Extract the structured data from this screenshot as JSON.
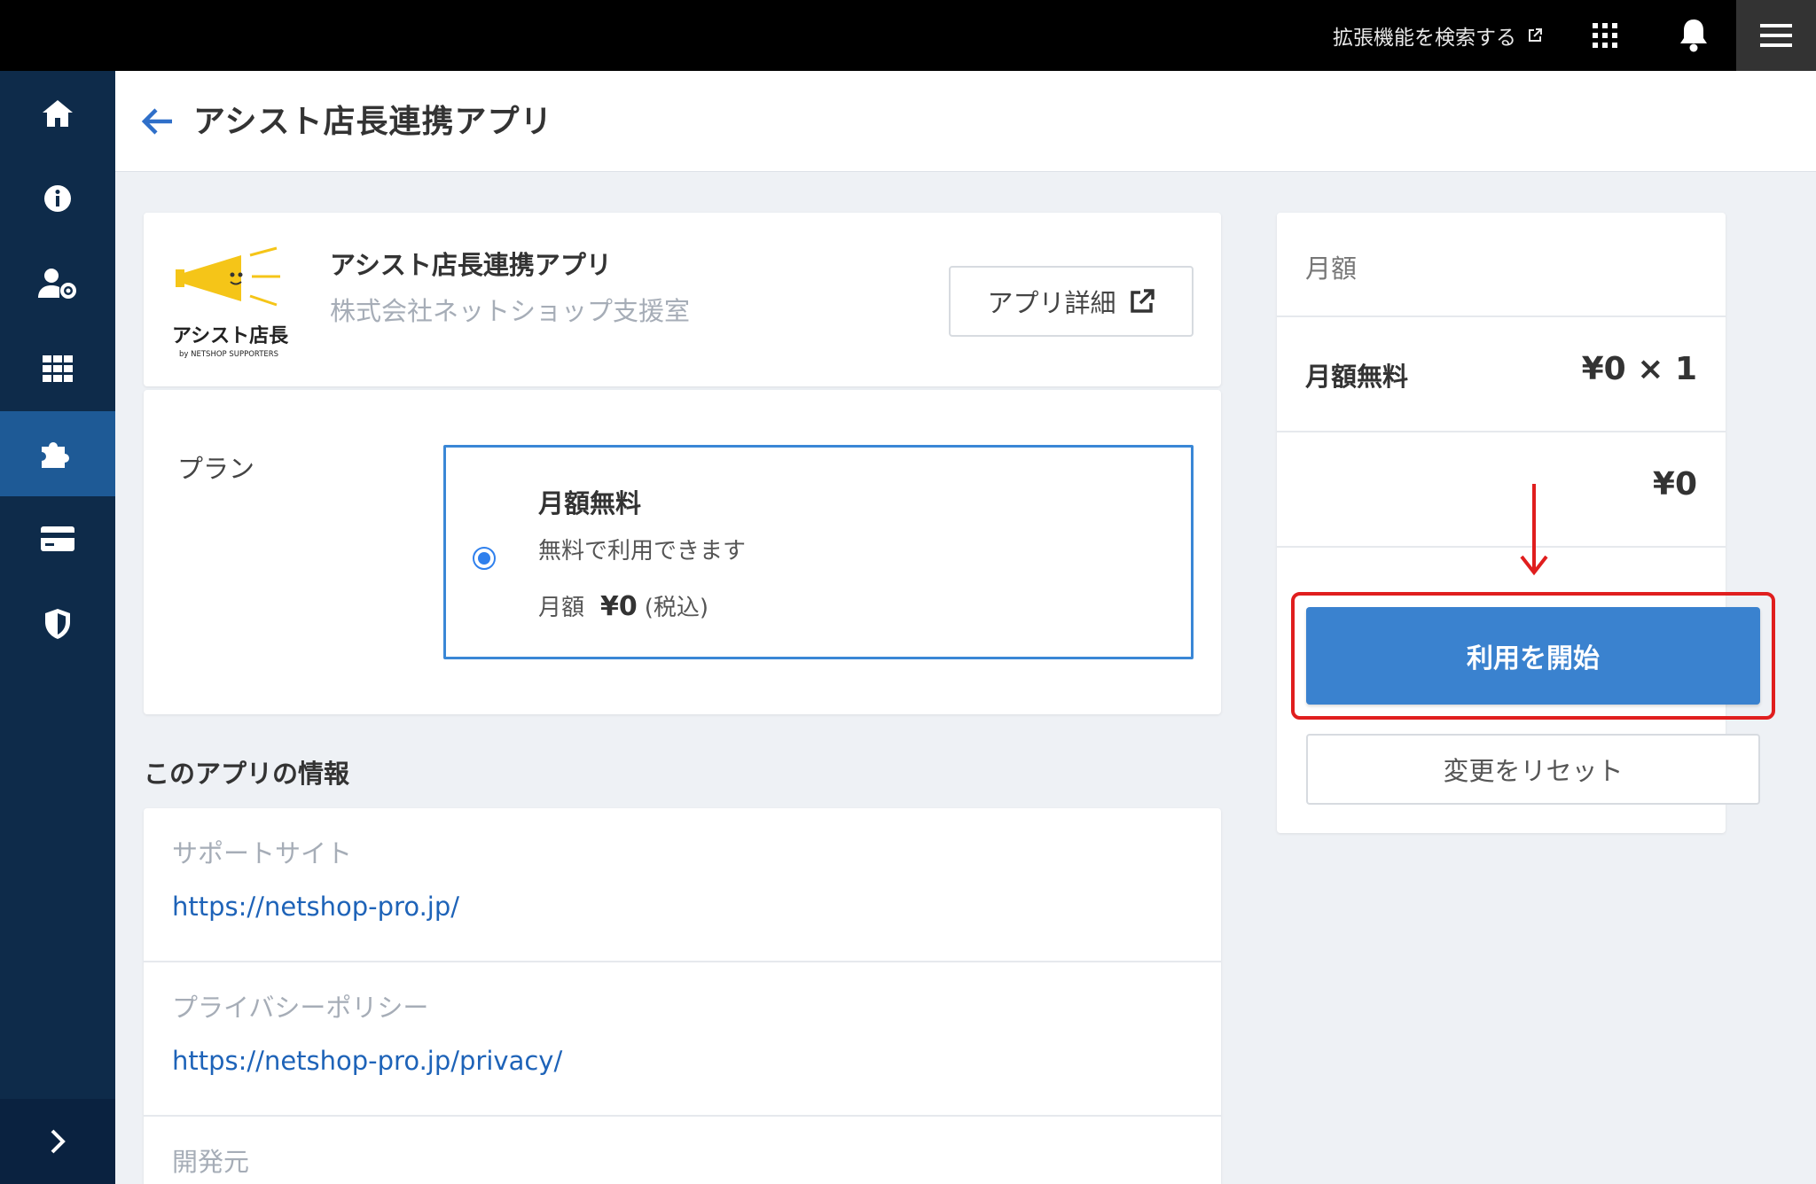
{
  "topbar": {
    "search_extensions_label": "拡張機能を検索する",
    "icons": [
      "external-link-icon",
      "apps-grid-icon",
      "bell-icon",
      "hamburger-menu-icon"
    ]
  },
  "sidebar": {
    "items": [
      {
        "name": "home",
        "icon": "home-icon"
      },
      {
        "name": "info",
        "icon": "info-icon"
      },
      {
        "name": "user-settings",
        "icon": "user-gear-icon"
      },
      {
        "name": "apps",
        "icon": "grid-icon"
      },
      {
        "name": "extensions",
        "icon": "puzzle-icon",
        "active": true
      },
      {
        "name": "billing",
        "icon": "credit-card-icon"
      },
      {
        "name": "security",
        "icon": "shield-icon"
      }
    ],
    "expand_icon": "chevron-right-icon"
  },
  "header": {
    "title": "アシスト店長連携アプリ"
  },
  "app": {
    "name": "アシスト店長連携アプリ",
    "company": "株式会社ネットショップ支援室",
    "logo_text": "アシスト店長",
    "logo_subtext": "by NETSHOP SUPPORTERS",
    "detail_button": "アプリ詳細"
  },
  "plan": {
    "label": "プラン",
    "option": {
      "name": "月額無料",
      "description": "無料で利用できます",
      "price_label": "月額",
      "price": "¥0",
      "tax": "(税込)",
      "selected": true
    }
  },
  "info": {
    "heading": "このアプリの情報",
    "rows": [
      {
        "label": "サポートサイト",
        "value": "https://netshop-pro.jp/"
      },
      {
        "label": "プライバシーポリシー",
        "value": "https://netshop-pro.jp/privacy/"
      },
      {
        "label": "開発元",
        "value": ""
      }
    ]
  },
  "summary": {
    "heading": "月額",
    "plan_name": "月額無料",
    "plan_price": "¥0 × 1",
    "total": "¥0",
    "start_button": "利用を開始",
    "reset_button": "変更をリセット"
  },
  "colors": {
    "topbar": "#000000",
    "sidebar": "#0e2b4a",
    "sidebar_active": "#1e5a96",
    "primary": "#3a82cf",
    "link": "#1e63b8",
    "highlight": "#e01e1e"
  }
}
